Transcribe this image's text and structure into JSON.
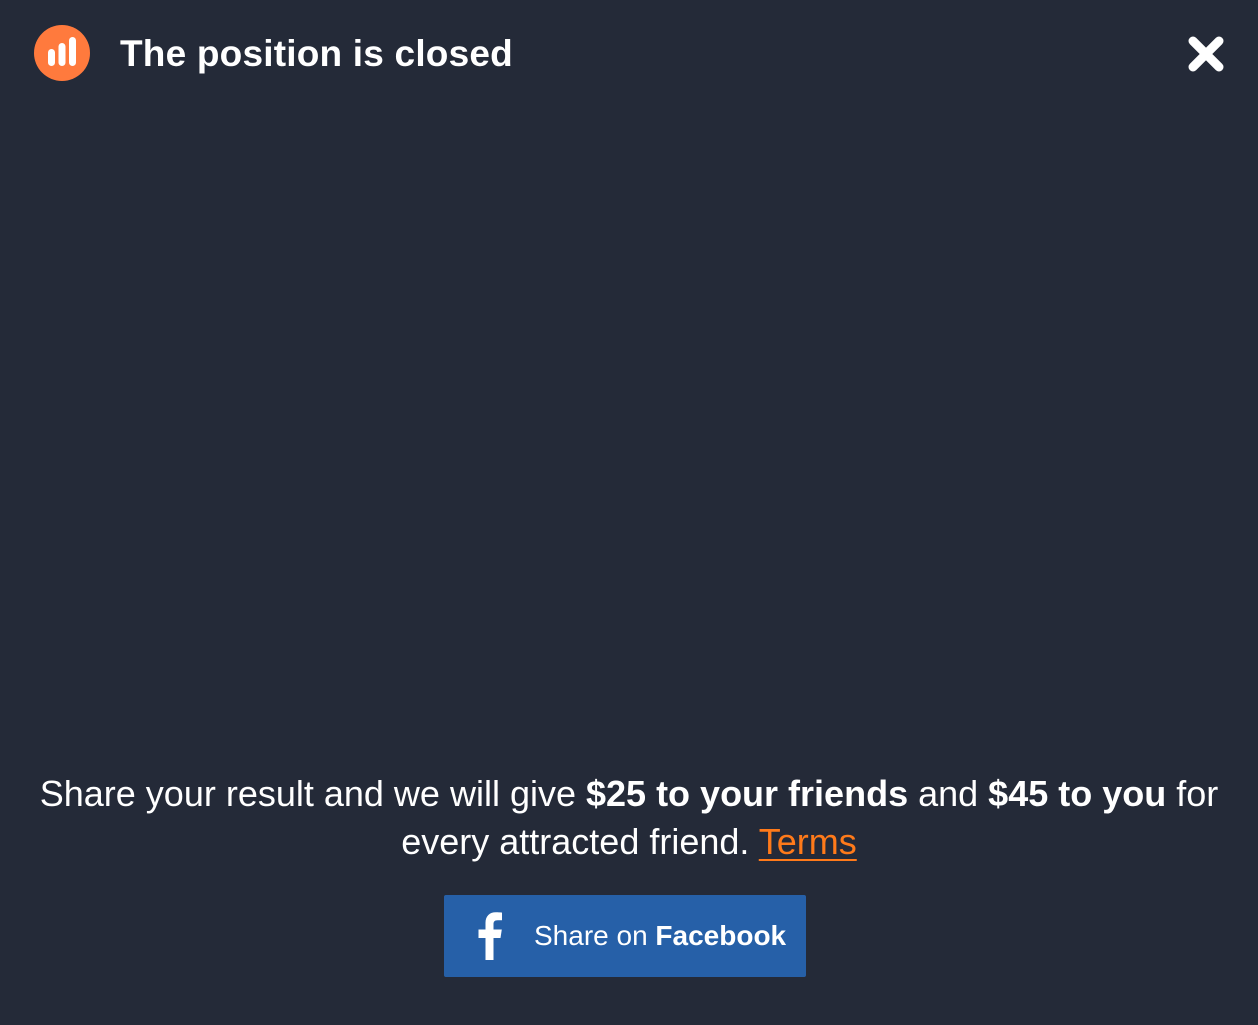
{
  "header": {
    "title": "The position is closed",
    "logo_icon": "bar-chart-logo-icon",
    "close_icon": "close-icon"
  },
  "message": {
    "part1": "Share your result and we will give ",
    "bold1": "$25 to your friends",
    "part2": " and ",
    "bold2": "$45 to you",
    "part3": " for every attracted friend. ",
    "terms_label": "Terms"
  },
  "share_button": {
    "icon": "facebook-icon",
    "label_prefix": "Share on ",
    "label_bold": "Facebook"
  },
  "colors": {
    "background": "#242a38",
    "accent": "#ff7a3d",
    "link": "#ff7a1a",
    "facebook": "#2660a8"
  }
}
